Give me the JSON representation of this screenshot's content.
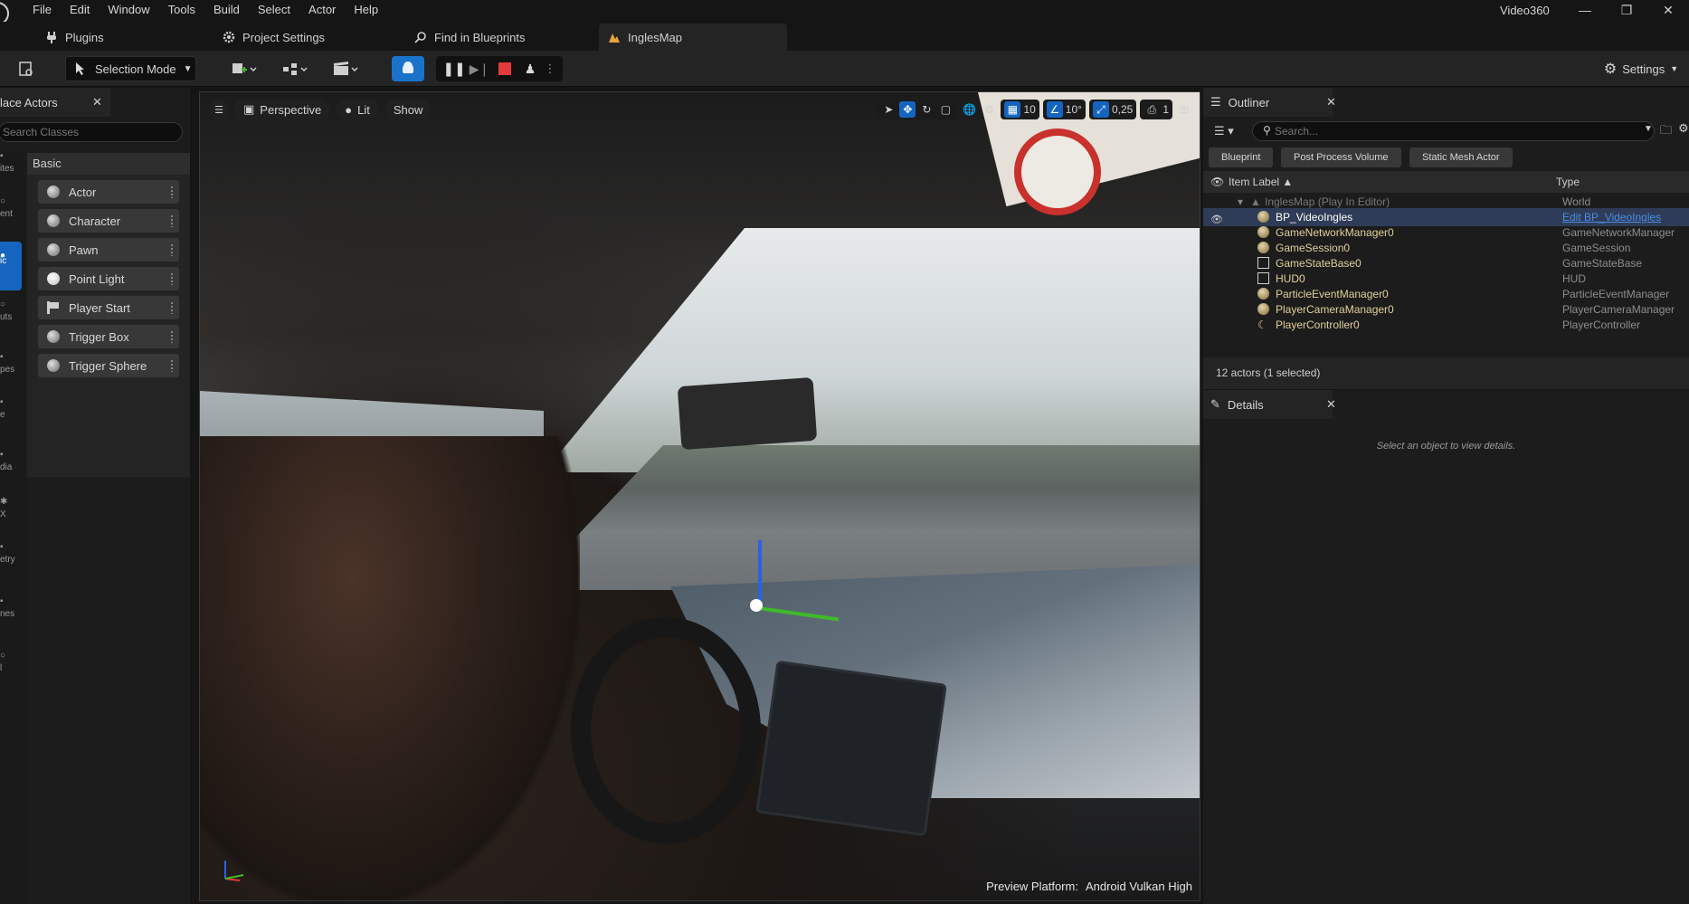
{
  "menu": [
    "File",
    "Edit",
    "Window",
    "Tools",
    "Build",
    "Select",
    "Actor",
    "Help"
  ],
  "project_name": "Video360",
  "doc_tabs": [
    {
      "label": "Plugins",
      "icon": "plug-icon"
    },
    {
      "label": "Project Settings",
      "icon": "settings-cog-icon"
    },
    {
      "label": "Find in Blueprints",
      "icon": "search-icon"
    },
    {
      "label": "InglesMap",
      "icon": "map-icon",
      "active": true
    }
  ],
  "toolbar": {
    "mode_label": "Selection Mode",
    "settings_label": "Settings",
    "play_color": "#1a73c8",
    "stop_color": "#e13a3a"
  },
  "place_actors": {
    "title": "lace Actors",
    "search_placeholder": "Search Classes",
    "category_header": "Basic",
    "categories": [
      "ites",
      "ent",
      "ic",
      "uts",
      "pes",
      "e",
      "dia",
      "X",
      "etry",
      "nes",
      "l"
    ],
    "items": [
      "Actor",
      "Character",
      "Pawn",
      "Point Light",
      "Player Start",
      "Trigger Box",
      "Trigger Sphere"
    ]
  },
  "viewport": {
    "view_mode": "Perspective",
    "lighting": "Lit",
    "show_label": "Show",
    "grid_snap": "10",
    "rotation_snap": "10°",
    "scale_snap": "0,25",
    "camera_speed": "1",
    "preview_platform_label": "Preview Platform:",
    "preview_platform_value": "Android Vulkan High"
  },
  "outliner": {
    "title": "Outliner",
    "search_placeholder": "Search...",
    "filters": [
      "Blueprint",
      "Post Process Volume",
      "Static Mesh Actor"
    ],
    "col_label": "Item Label ▲",
    "col_type": "Type",
    "rows": [
      {
        "label": "InglesMap (Play In Editor)",
        "type": "World",
        "kind": "world"
      },
      {
        "label": "BP_VideoIngles",
        "type": "Edit BP_VideoIngles",
        "kind": "selected"
      },
      {
        "label": "GameNetworkManager0",
        "type": "GameNetworkManager"
      },
      {
        "label": "GameSession0",
        "type": "GameSession"
      },
      {
        "label": "GameStateBase0",
        "type": "GameStateBase"
      },
      {
        "label": "HUD0",
        "type": "HUD"
      },
      {
        "label": "ParticleEventManager0",
        "type": "ParticleEventManager"
      },
      {
        "label": "PlayerCameraManager0",
        "type": "PlayerCameraManager"
      },
      {
        "label": "PlayerController0",
        "type": "PlayerController"
      }
    ],
    "footer": "12 actors (1 selected)"
  },
  "details": {
    "title": "Details",
    "empty_message": "Select an object to view details."
  }
}
